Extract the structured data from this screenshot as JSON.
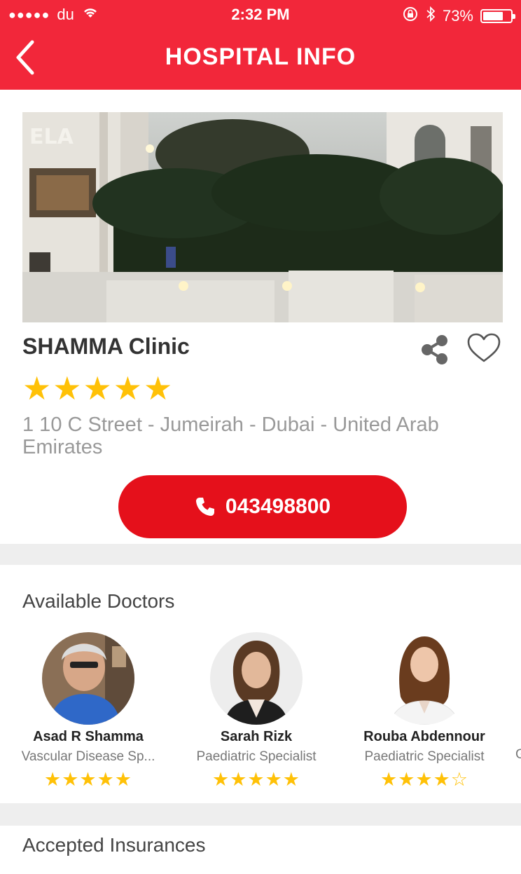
{
  "status_bar": {
    "carrier": "du",
    "time": "2:32 PM",
    "battery_percent": "73%",
    "battery_level": 0.73
  },
  "nav": {
    "title": "HOSPITAL INFO",
    "back_icon": "chevron-left-icon"
  },
  "clinic": {
    "name": "SHAMMA Clinic",
    "rating_stars": "★★★★★",
    "rating": 5,
    "address": "1 10 C Street - Jumeirah - Dubai - United Arab Emirates",
    "phone": "043498800"
  },
  "colors": {
    "brand_red": "#f2273a",
    "call_red": "#e5101b",
    "star_yellow": "#ffc107"
  },
  "sections": {
    "doctors_title": "Available Doctors",
    "insurances_title": "Accepted Insurances"
  },
  "doctors": [
    {
      "name": "Asad R Shamma",
      "specialty": "Vascular Disease Sp...",
      "stars": "★★★★★",
      "rating": 5
    },
    {
      "name": "Sarah Rizk",
      "specialty": "Paediatric Specialist",
      "stars": "★★★★★",
      "rating": 5
    },
    {
      "name": "Rouba Abdennour",
      "specialty": "Paediatric Specialist",
      "stars": "★★★★☆",
      "rating": 4.5
    }
  ],
  "partial_doctor_specialty": "G"
}
